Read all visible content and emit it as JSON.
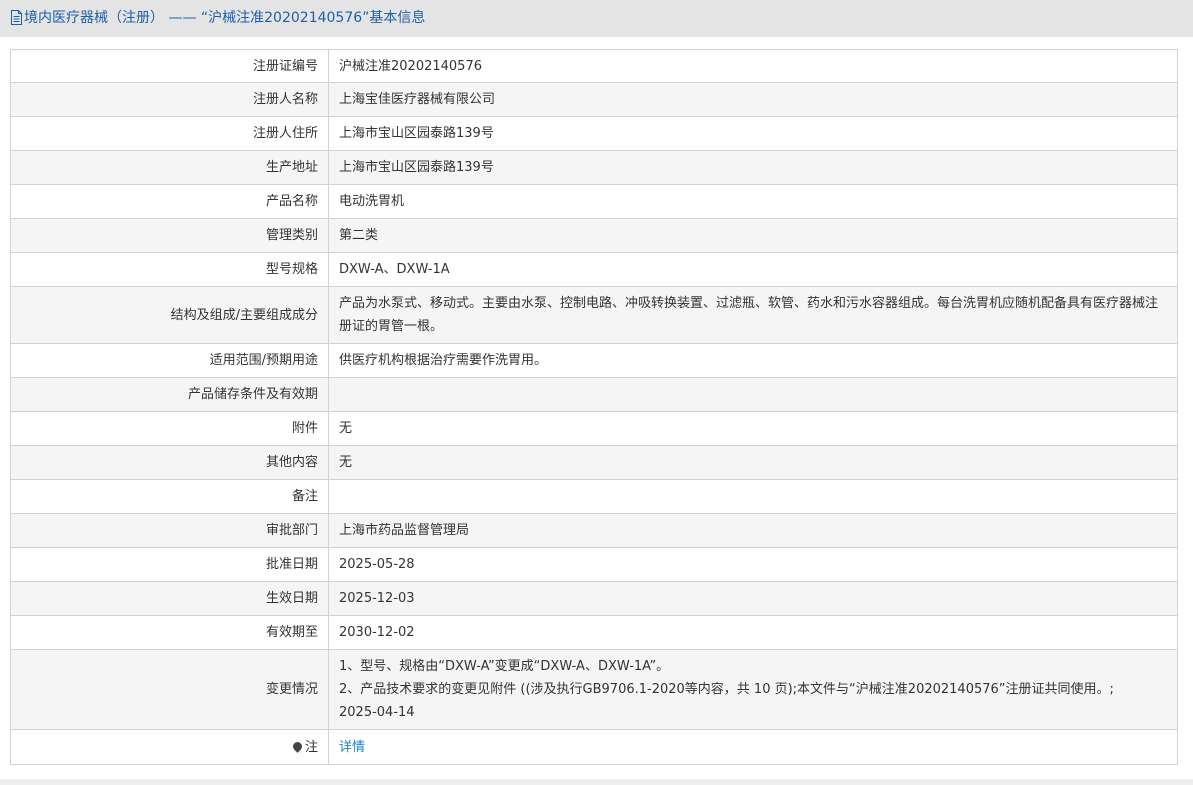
{
  "header": {
    "title": "境内医疗器械（注册） —— “沪械注准20202140576”基本信息"
  },
  "rows": [
    {
      "label": "注册证编号",
      "value": "沪械注准20202140576"
    },
    {
      "label": "注册人名称",
      "value": "上海宝佳医疗器械有限公司"
    },
    {
      "label": "注册人住所",
      "value": "上海市宝山区园泰路139号"
    },
    {
      "label": "生产地址",
      "value": "上海市宝山区园泰路139号"
    },
    {
      "label": "产品名称",
      "value": "电动洗胃机"
    },
    {
      "label": "管理类别",
      "value": "第二类"
    },
    {
      "label": "型号规格",
      "value": "DXW-A、DXW-1A"
    },
    {
      "label": "结构及组成/主要组成成分",
      "value": "产品为水泵式、移动式。主要由水泵、控制电路、冲吸转换装置、过滤瓶、软管、药水和污水容器组成。每台洗胃机应随机配备具有医疗器械注册证的胃管一根。"
    },
    {
      "label": "适用范围/预期用途",
      "value": "供医疗机构根据治疗需要作洗胃用。"
    },
    {
      "label": "产品储存条件及有效期",
      "value": ""
    },
    {
      "label": "附件",
      "value": "无"
    },
    {
      "label": "其他内容",
      "value": "无"
    },
    {
      "label": "备注",
      "value": ""
    },
    {
      "label": "审批部门",
      "value": "上海市药品监督管理局"
    },
    {
      "label": "批准日期",
      "value": "2025-05-28"
    },
    {
      "label": "生效日期",
      "value": "2025-12-03"
    },
    {
      "label": "有效期至",
      "value": "2030-12-02"
    }
  ],
  "changes": {
    "label": "变更情况",
    "lines": [
      "1、型号、规格由“DXW-A”变更成“DXW-A、DXW-1A”。",
      "2、产品技术要求的变更见附件 ((涉及执行GB9706.1-2020等内容，共 10 页);本文件与“沪械注准20202140576”注册证共同使用。;",
      "2025-04-14"
    ]
  },
  "note": {
    "label": "注",
    "link_text": "详情",
    "icon": "map-pin-icon"
  }
}
